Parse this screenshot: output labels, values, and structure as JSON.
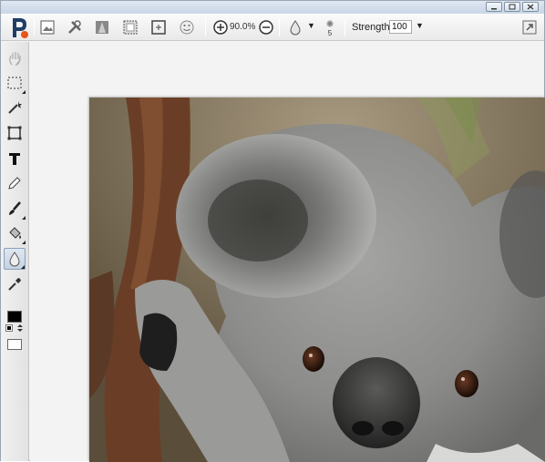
{
  "app": {
    "logo_letter": "P",
    "window_controls": [
      "minimize",
      "maximize",
      "close"
    ]
  },
  "toolbar": {
    "zoom_value": "90.0%",
    "brush_size": "5",
    "strength_label": "Strength",
    "strength_value": "100",
    "icons": [
      "image-icon",
      "tools-icon",
      "filter-icon",
      "frame-icon",
      "resize-icon",
      "smiley-icon",
      "zoom-in-icon",
      "zoom-out-icon",
      "blur-drop-icon",
      "brush-size-icon",
      "fullscreen-icon"
    ]
  },
  "tools": [
    "hand",
    "marquee",
    "magic-wand",
    "crop",
    "text",
    "pencil",
    "brush",
    "fill",
    "blur",
    "eyedropper"
  ],
  "colors": {
    "accent": "#1e5a8f",
    "foreground": "#000000",
    "background": "#ffffff"
  },
  "canvas": {
    "image_subject": "koala"
  }
}
